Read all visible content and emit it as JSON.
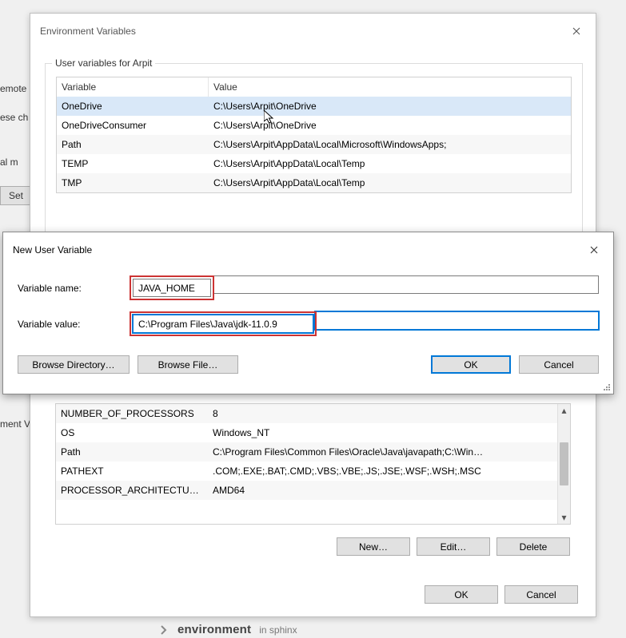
{
  "fragments": {
    "remote": "emote",
    "ese_ch": "ese ch",
    "al_m": "al m",
    "set": "Set",
    "ment_v": "ment V"
  },
  "env_dialog": {
    "title": "Environment Variables",
    "user_legend": "User variables for Arpit",
    "columns": {
      "var": "Variable",
      "val": "Value"
    },
    "user_rows": [
      {
        "var": "OneDrive",
        "val": "C:\\Users\\Arpit\\OneDrive",
        "sel": true
      },
      {
        "var": "OneDriveConsumer",
        "val": "C:\\Users\\Arpit\\OneDrive"
      },
      {
        "var": "Path",
        "val": "C:\\Users\\Arpit\\AppData\\Local\\Microsoft\\WindowsApps;"
      },
      {
        "var": "TEMP",
        "val": "C:\\Users\\Arpit\\AppData\\Local\\Temp"
      },
      {
        "var": "TMP",
        "val": "C:\\Users\\Arpit\\AppData\\Local\\Temp"
      }
    ],
    "sys_rows": [
      {
        "var": "NUMBER_OF_PROCESSORS",
        "val": "8"
      },
      {
        "var": "OS",
        "val": "Windows_NT"
      },
      {
        "var": "Path",
        "val": "C:\\Program Files\\Common Files\\Oracle\\Java\\javapath;C:\\Win…"
      },
      {
        "var": "PATHEXT",
        "val": ".COM;.EXE;.BAT;.CMD;.VBS;.VBE;.JS;.JSE;.WSF;.WSH;.MSC"
      },
      {
        "var": "PROCESSOR_ARCHITECTU…",
        "val": "AMD64"
      }
    ],
    "buttons": {
      "new": "New…",
      "edit": "Edit…",
      "delete": "Delete",
      "ok": "OK",
      "cancel": "Cancel"
    }
  },
  "nuv": {
    "title": "New User Variable",
    "name_label": "Variable name:",
    "name_value": "JAVA_HOME",
    "value_label": "Variable value:",
    "value_value": "C:\\Program Files\\Java\\jdk-11.0.9",
    "browse_dir": "Browse Directory…",
    "browse_file": "Browse File…",
    "ok": "OK",
    "cancel": "Cancel"
  },
  "bottom": {
    "label": "environment",
    "sub": "in sphinx"
  }
}
